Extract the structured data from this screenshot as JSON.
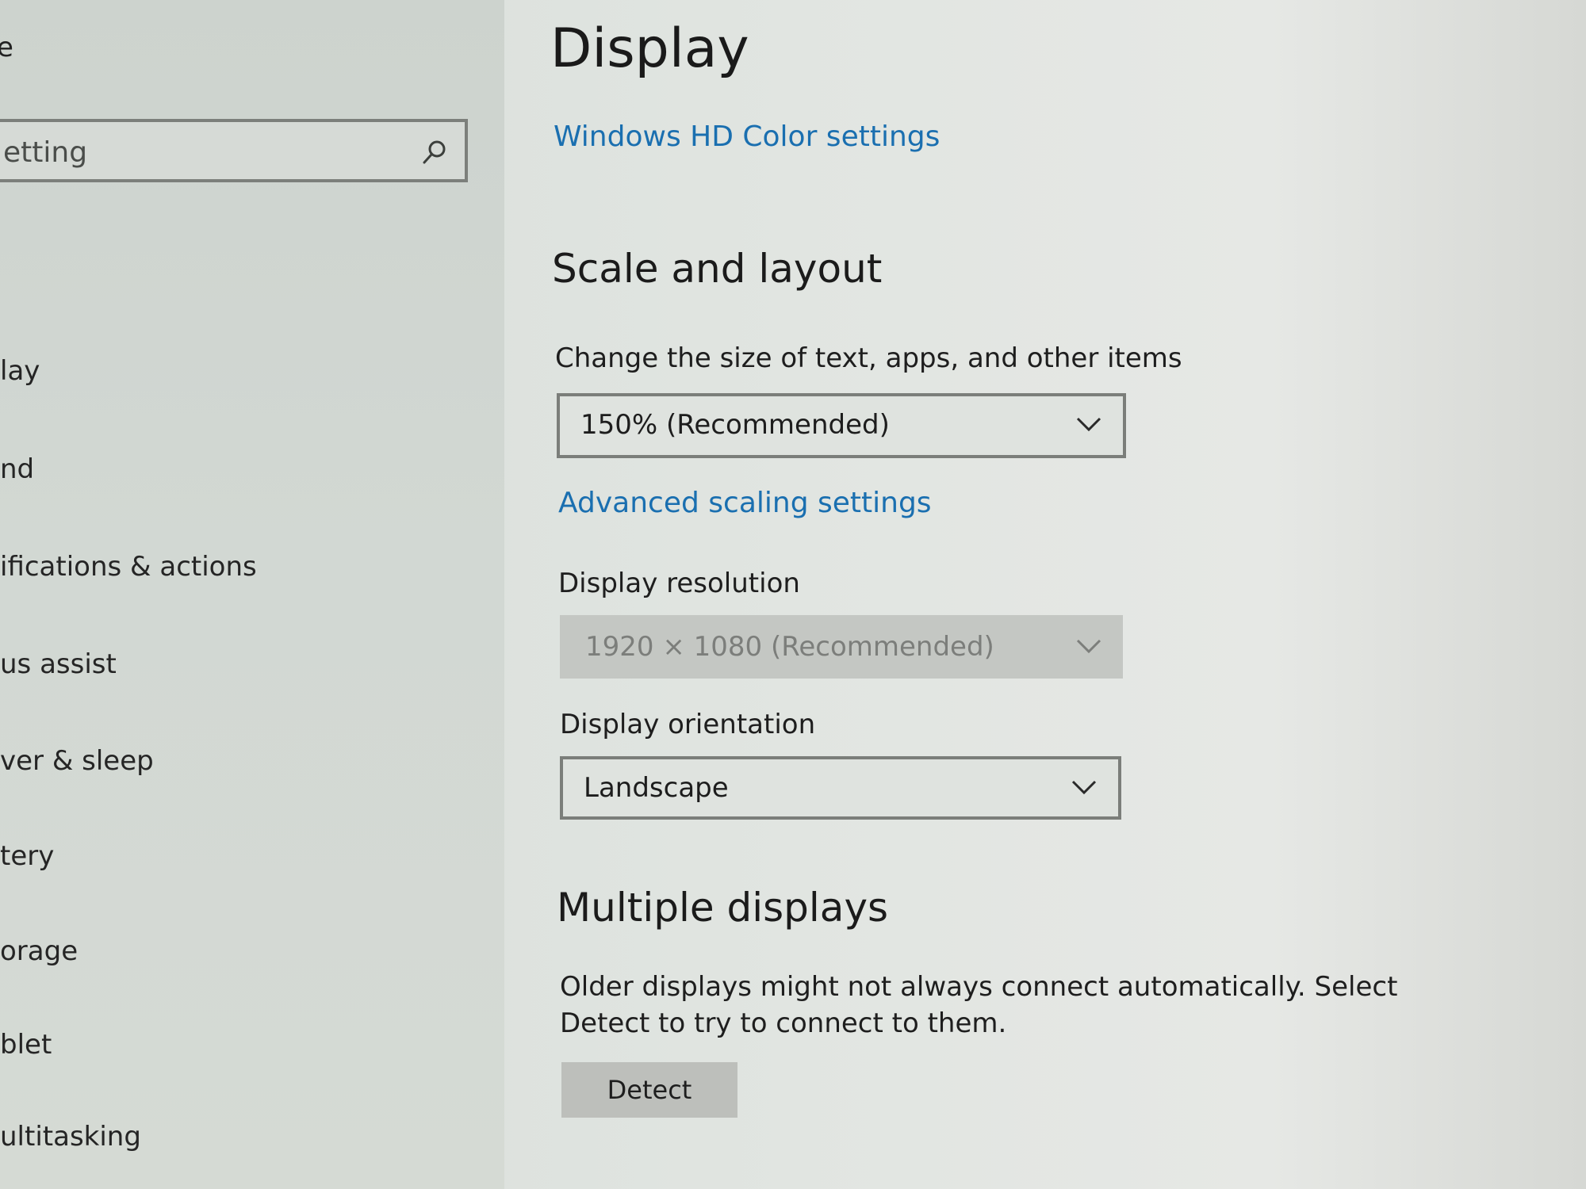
{
  "sidebar": {
    "title": "e",
    "search": {
      "text": "etting"
    },
    "items": [
      {
        "label": "lay"
      },
      {
        "label": "nd"
      },
      {
        "label": "ifications & actions"
      },
      {
        "label": "us assist"
      },
      {
        "label": "ver & sleep"
      },
      {
        "label": "tery"
      },
      {
        "label": "orage"
      },
      {
        "label": "blet"
      },
      {
        "label": "ultitasking"
      }
    ]
  },
  "main": {
    "title": "Display",
    "hd_color_link": "Windows HD Color settings",
    "scale_section": {
      "heading": "Scale and layout",
      "size_label": "Change the size of text, apps, and other items",
      "size_value": "150% (Recommended)",
      "advanced_scaling_link": "Advanced scaling settings",
      "resolution_label": "Display resolution",
      "resolution_value": "1920 × 1080 (Recommended)",
      "orientation_label": "Display orientation",
      "orientation_value": "Landscape"
    },
    "multiple_displays": {
      "heading": "Multiple displays",
      "description": "Older displays might not always connect automatically. Select Detect to try to connect to them.",
      "detect_button": "Detect"
    }
  },
  "colors": {
    "link": "#1a6fb0",
    "text": "#1e1e1e",
    "background": "#dfe3df"
  }
}
